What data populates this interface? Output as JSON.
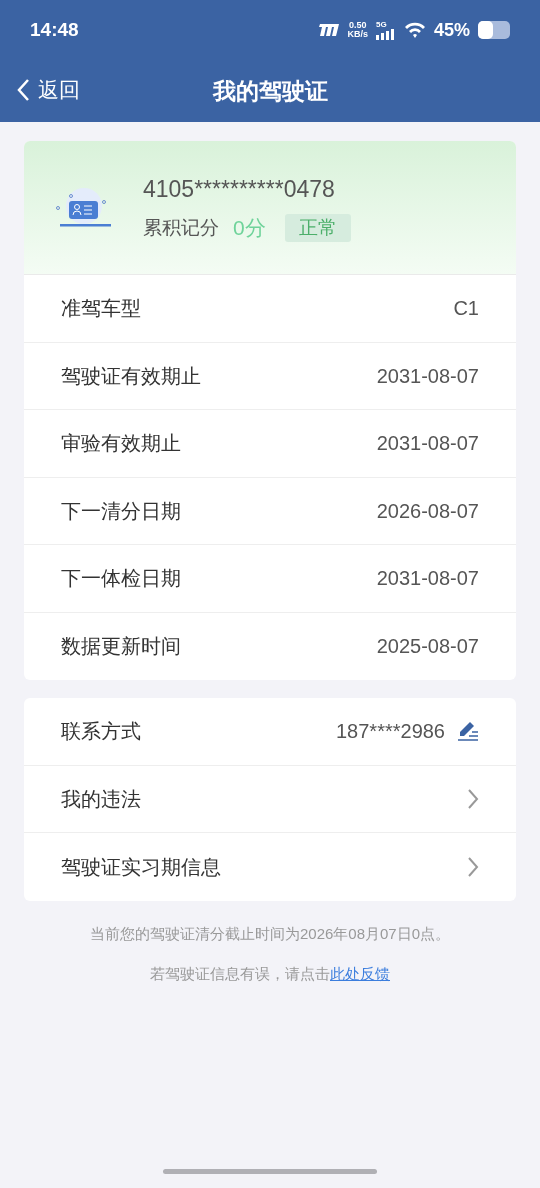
{
  "status_bar": {
    "time": "14:48",
    "speed_value": "0.50",
    "speed_unit": "KB/s",
    "network": "5G",
    "battery": "45%"
  },
  "nav": {
    "back": "返回",
    "title": "我的驾驶证"
  },
  "license": {
    "number": "4105**********0478",
    "points_label": "累积记分",
    "points": "0分",
    "status": "正常"
  },
  "details": [
    {
      "label": "准驾车型",
      "value": "C1"
    },
    {
      "label": "驾驶证有效期止",
      "value": "2031-08-07"
    },
    {
      "label": "审验有效期止",
      "value": "2031-08-07"
    },
    {
      "label": "下一清分日期",
      "value": "2026-08-07"
    },
    {
      "label": "下一体检日期",
      "value": "2031-08-07"
    },
    {
      "label": "数据更新时间",
      "value": "2025-08-07"
    }
  ],
  "actions": [
    {
      "kind": "edit",
      "label": "联系方式",
      "value": "187****2986"
    },
    {
      "kind": "link",
      "label": "我的违法"
    },
    {
      "kind": "link",
      "label": "驾驶证实习期信息"
    }
  ],
  "notice": "当前您的驾驶证清分截止时间为2026年08月07日0点。",
  "feedback": {
    "text": "若驾驶证信息有误，请点击",
    "link": "此处反馈"
  }
}
